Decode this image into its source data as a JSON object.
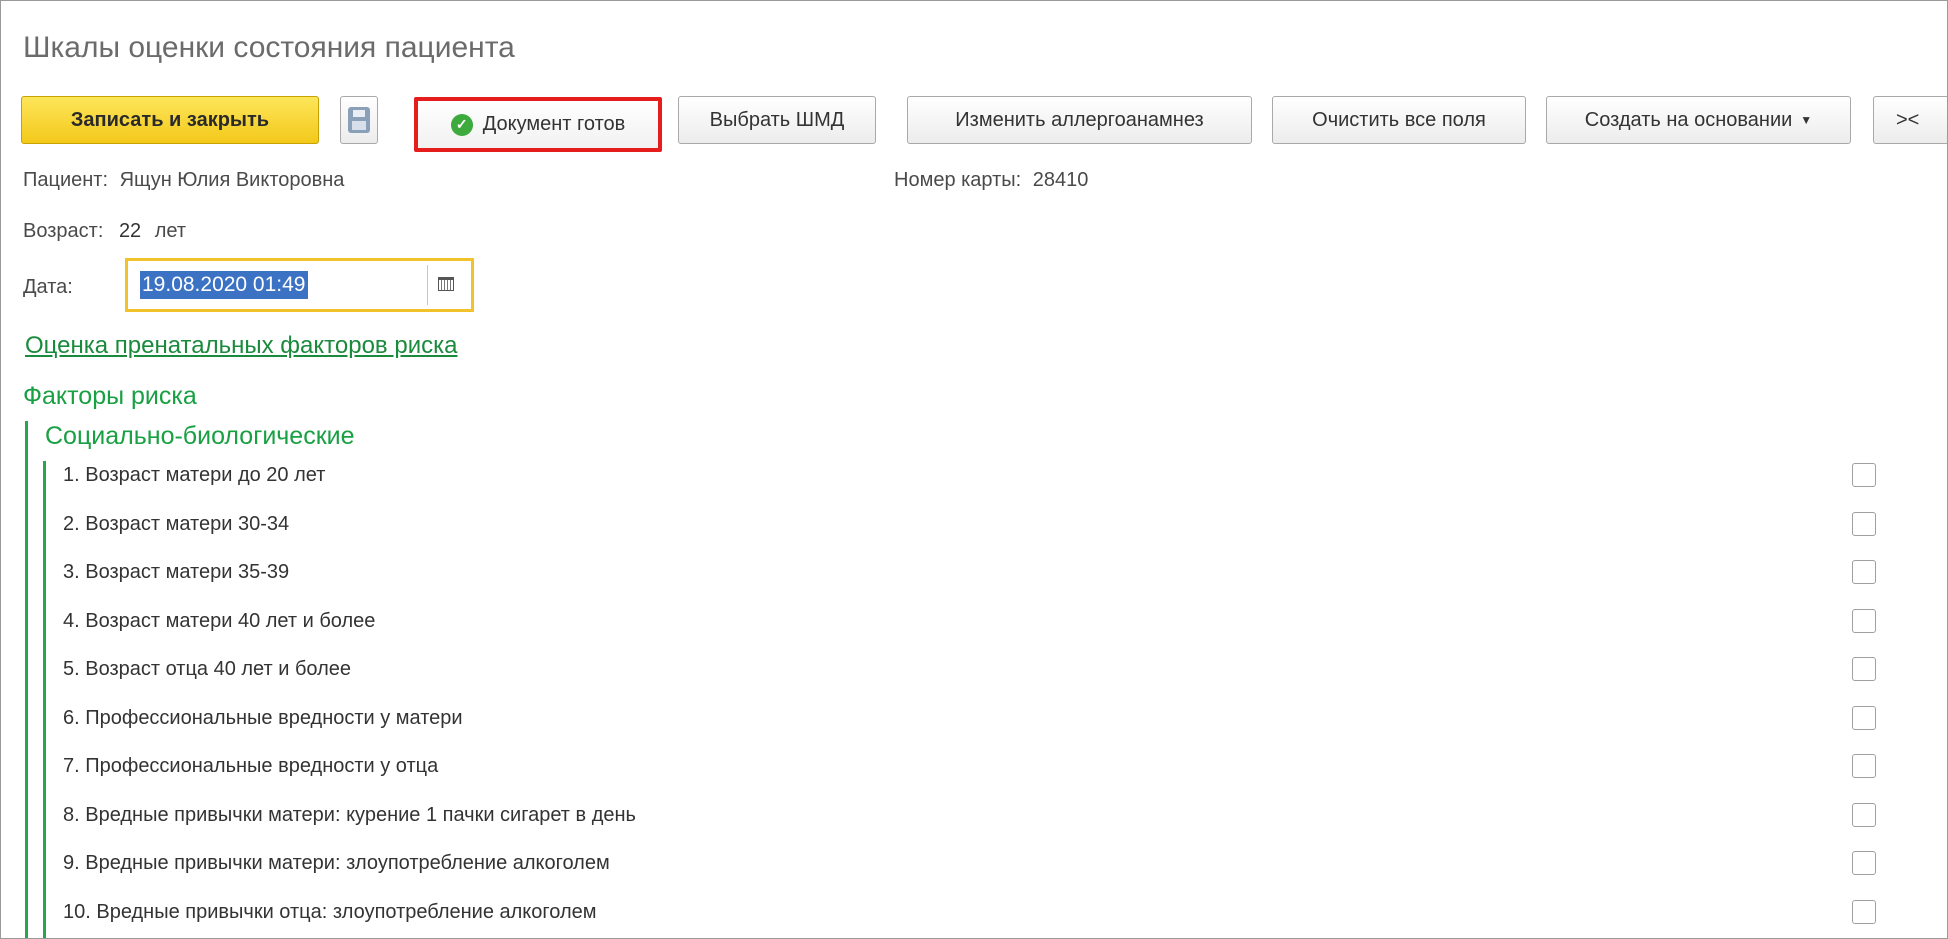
{
  "window": {
    "title": "Шкалы оценки состояния пациента"
  },
  "toolbar": {
    "save_close_label": "Записать и закрыть",
    "document_ready_label": "Документ готов",
    "choose_shmd_label": "Выбрать ШМД",
    "change_allergo_label": "Изменить аллергоанамнез",
    "clear_all_label": "Очистить все поля",
    "create_based_label": "Создать на основании",
    "collapse_label": "><"
  },
  "patient": {
    "label": "Пациент:",
    "name": "Ящун Юлия Викторовна",
    "card_label": "Номер карты:",
    "card_number": "28410",
    "age_label": "Возраст:",
    "age_value": "22",
    "age_unit": "лет"
  },
  "date": {
    "label": "Дата:",
    "value": "19.08.2020 01:49"
  },
  "link_prenatal": "Оценка пренатальных факторов риска",
  "risk_factors": {
    "title": "Факторы риска",
    "group": "Социально-биологические",
    "items": [
      {
        "label": "1. Возраст матери до 20 лет",
        "checked": false
      },
      {
        "label": "2. Возраст матери 30-34",
        "checked": false
      },
      {
        "label": "3. Возраст матери 35-39",
        "checked": false
      },
      {
        "label": "4. Возраст матери 40 лет и более",
        "checked": false
      },
      {
        "label": "5. Возраст отца 40 лет и более",
        "checked": false
      },
      {
        "label": "6. Профессиональные вредности у матери",
        "checked": false
      },
      {
        "label": "7. Профессиональные вредности у отца",
        "checked": false
      },
      {
        "label": "8. Вредные привычки матери: курение 1 пачки сигарет в день",
        "checked": false
      },
      {
        "label": "9. Вредные привычки матери: злоупотребление алкоголем",
        "checked": false
      },
      {
        "label": "10. Вредные привычки отца: злоупотребление алкоголем",
        "checked": false
      }
    ]
  },
  "colors": {
    "accent_green": "#18a042",
    "primary_button": "#f3c81a",
    "highlight_red": "#e51d1d",
    "date_selection": "#3c72c4"
  }
}
